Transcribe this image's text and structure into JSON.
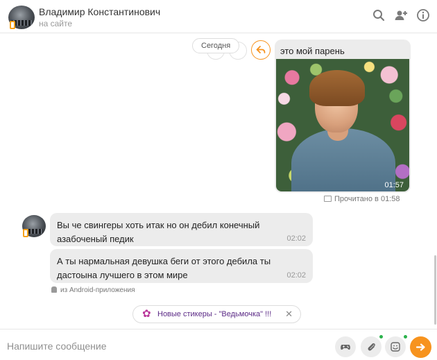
{
  "header": {
    "name": "Владимир Константинович",
    "status": "на сайте",
    "icons": [
      "search-icon",
      "add-user-icon",
      "info-icon"
    ]
  },
  "chat": {
    "date_label": "Сегодня",
    "outgoing": {
      "text": "это мой парень",
      "photo_time": "01:57",
      "read_status": "Прочитано в 01:58"
    },
    "incoming": [
      {
        "text": "Вы че свингеры хоть итак но он дебил конечный азабоченый педик",
        "time": "02:02"
      },
      {
        "text": "А ты нармальная девушка беги от этого дебила ты дастоына лучшего в этом мире",
        "time": "02:02"
      }
    ],
    "source": "из Android-приложения",
    "sticker_promo": "Новые стикеры - \"Ведьмочка\" !!!"
  },
  "composer": {
    "placeholder": "Напишите сообщение",
    "buttons": [
      "gamepad-icon",
      "paperclip-icon",
      "smiley-icon",
      "send-icon"
    ]
  },
  "colors": {
    "accent": "#f7931e",
    "bubble": "#ececec",
    "online_dot": "#2bb24c"
  }
}
